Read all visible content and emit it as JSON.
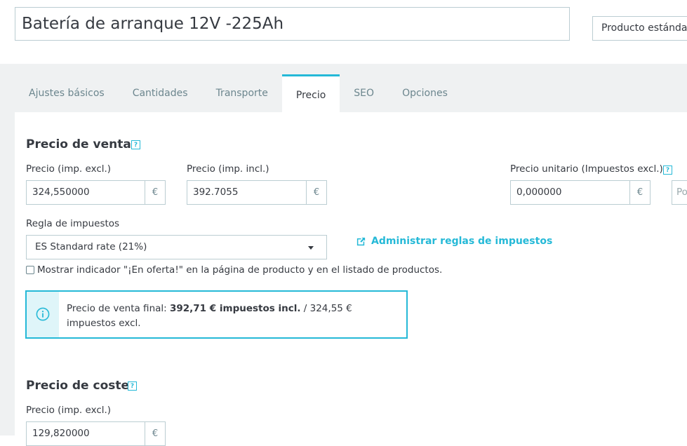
{
  "header": {
    "product_name": "Batería de arranque 12V -225Ah",
    "product_type": "Producto estándar"
  },
  "tabs": [
    {
      "label": "Ajustes básicos"
    },
    {
      "label": "Cantidades"
    },
    {
      "label": "Transporte"
    },
    {
      "label": "Precio"
    },
    {
      "label": "SEO"
    },
    {
      "label": "Opciones"
    }
  ],
  "active_tab": "Precio",
  "sale_price": {
    "title": "Precio de venta",
    "price_excl_label": "Precio (imp. excl.)",
    "price_excl_value": "324,550000",
    "price_incl_label": "Precio (imp. incl.)",
    "price_incl_value": "392.7055",
    "currency": "€",
    "unit_price_label": "Precio unitario (Impuestos excl.)",
    "unit_price_value": "0,000000",
    "unit_per_placeholder": "Po",
    "tax_rule_label": "Regla de impuestos",
    "tax_rule_value": "ES Standard rate (21%)",
    "manage_tax_rules": "Administrar reglas de impuestos",
    "on_sale_label": "Mostrar indicador \"¡En oferta!\" en la página de producto y en el listado de productos.",
    "final_price_prefix": "Precio de venta final: ",
    "final_price_incl": "392,71 € impuestos incl.",
    "final_price_suffix": " / 324,55 € impuestos excl."
  },
  "cost_price": {
    "title": "Precio de coste",
    "price_excl_label": "Precio (imp. excl.)",
    "price_excl_value": "129,820000",
    "currency": "€"
  },
  "colors": {
    "accent": "#25b9d7",
    "border": "#bbcdd2",
    "text": "#363a41",
    "muted": "#6c868e",
    "band": "#eff1f2"
  }
}
